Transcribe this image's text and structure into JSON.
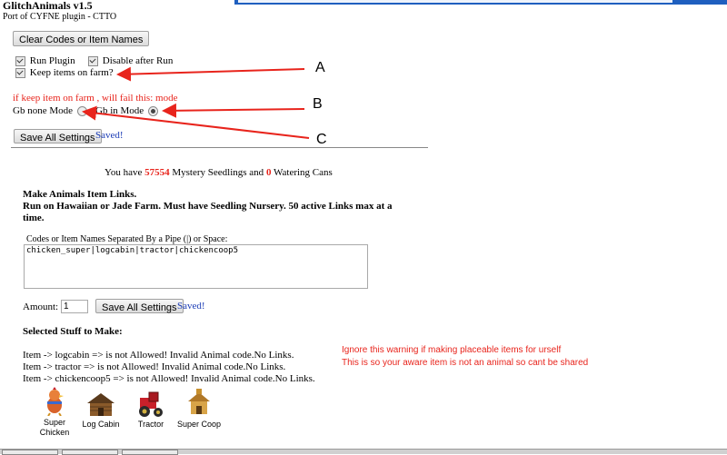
{
  "header": {
    "title": "GlitchAnimals v1.5",
    "subtitle": "Port of CYFNE plugin - CTTO"
  },
  "buttons": {
    "clear": "Clear Codes or Item Names",
    "save_settings": "Save All Settings"
  },
  "options": {
    "run_plugin": "Run Plugin",
    "disable_after_run": "Disable after Run",
    "keep_items": "Keep items on farm?"
  },
  "annotations": {
    "a": "A",
    "b": "B",
    "c": "C",
    "warning_mode": "if keep item on farm , will fail this: mode",
    "ignore_1": "Ignore this warning  if making placeable items for urself",
    "ignore_2": "This is so your aware item is not an animal so cant be shared",
    "accent": "#e8241c"
  },
  "modes": {
    "gb_none": "Gb none Mode",
    "gb_in": "Gb in Mode"
  },
  "status": {
    "saved": "Saved!"
  },
  "counts": {
    "prefix": "You have",
    "seedlings": "57554",
    "middle": "Mystery Seedlings and",
    "cans": "0",
    "suffix": "Watering Cans"
  },
  "section": {
    "title": "Make Animals Item Links.",
    "line2": "Run on Hawaiian or Jade Farm. Must have Seedling Nursery. 50 active Links max at a time."
  },
  "codes": {
    "label": "Codes or Item Names Separated By a Pipe (|) or Space:",
    "value": "chicken_super|logcabin|tractor|chickencoop5"
  },
  "amount": {
    "label": "Amount:",
    "value": "1"
  },
  "selected": {
    "title": "Selected Stuff to Make:",
    "items": [
      "Item -> logcabin => is not Allowed! Invalid Animal code.No Links.",
      "Item -> tractor => is not Allowed! Invalid Animal code.No Links.",
      "Item -> chickencoop5 => is not Allowed! Invalid Animal code.No Links."
    ]
  },
  "gallery": [
    {
      "label": "Super Chicken",
      "icon": "super-chicken-icon"
    },
    {
      "label": "Log Cabin",
      "icon": "log-cabin-icon"
    },
    {
      "label": "Tractor",
      "icon": "tractor-icon"
    },
    {
      "label": "Super Coop",
      "icon": "super-coop-icon"
    }
  ]
}
